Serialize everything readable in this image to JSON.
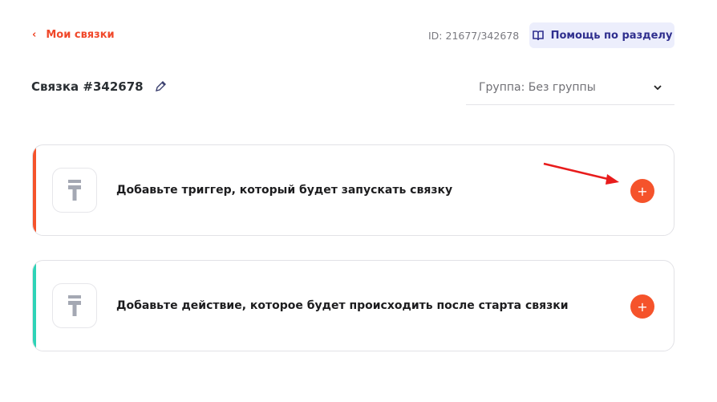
{
  "header": {
    "back_label": "Мои связки",
    "id_text": "ID: 21677/342678",
    "help_label": "Помощь по разделу"
  },
  "title": "Связка #342678",
  "group": {
    "value": "Группа: Без группы"
  },
  "cards": [
    {
      "text": "Добавьте триггер, который будет запускать связку",
      "plus": "+",
      "accent": "#f5532b"
    },
    {
      "text": "Добавьте действие, которое будет происходить после старта связки",
      "plus": "+",
      "accent": "#2ed3b7"
    }
  ]
}
